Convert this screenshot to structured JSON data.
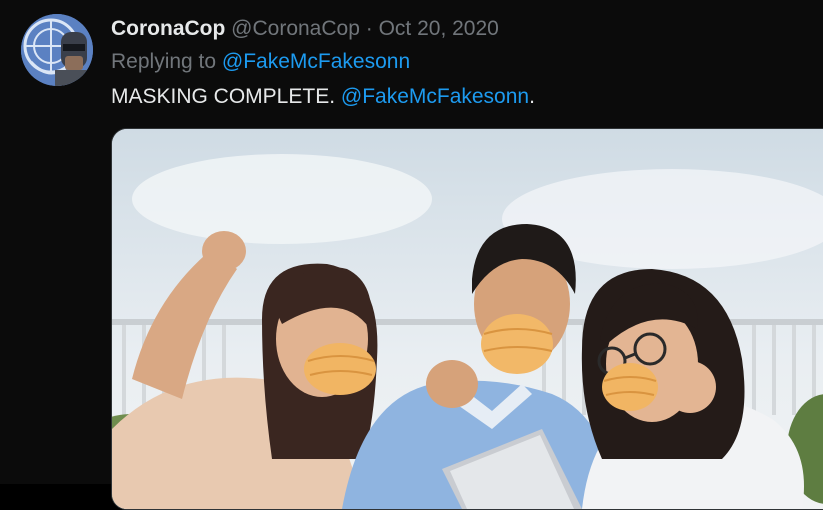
{
  "tweet": {
    "display_name": "CoronaCop",
    "handle": "@CoronaCop",
    "separator": "·",
    "date": "Oct 20, 2020",
    "replying_to_label": "Replying to",
    "replying_to_handle": "@FakeMcFakesonn",
    "text_before": "MASKING COMPLETE. ",
    "text_mention": "@FakeMcFakesonn",
    "text_after": "."
  },
  "colors": {
    "background": "#0b0b0b",
    "primary_text": "#e7e9ea",
    "secondary_text": "#71767b",
    "link": "#1d9bf0"
  },
  "icons": {
    "avatar": "robocop-un-logo-avatar"
  },
  "media": {
    "subject": "three-people-cheering-with-orange-masks"
  }
}
